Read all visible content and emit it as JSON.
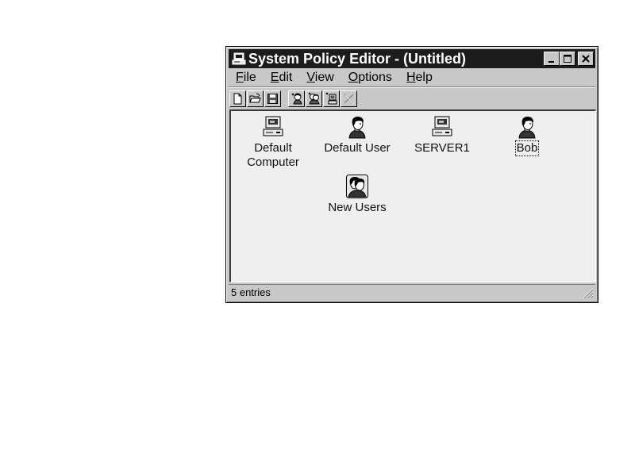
{
  "window": {
    "title": "System Policy Editor - (Untitled)",
    "icon": "policy-editor-icon",
    "controls": {
      "minimize_icon": "minimize-icon",
      "maximize_icon": "maximize-icon",
      "close_icon": "close-icon"
    }
  },
  "menu": [
    {
      "accel": "F",
      "rest": "ile"
    },
    {
      "accel": "E",
      "rest": "dit"
    },
    {
      "accel": "V",
      "rest": "iew"
    },
    {
      "accel": "O",
      "rest": "ptions"
    },
    {
      "accel": "H",
      "rest": "elp"
    }
  ],
  "toolbar": [
    {
      "icon": "new-document-icon"
    },
    {
      "icon": "open-folder-icon"
    },
    {
      "icon": "save-disk-icon"
    },
    {
      "icon": "add-user-icon"
    },
    {
      "icon": "add-group-icon"
    },
    {
      "icon": "add-computer-icon"
    },
    {
      "icon": "remove-icon",
      "disabled": true
    }
  ],
  "entries": [
    {
      "label_line1": "Default",
      "label_line2": "Computer",
      "icon": "computer-icon"
    },
    {
      "label_line1": "Default User",
      "label_line2": "",
      "icon": "user-icon"
    },
    {
      "label_line1": "SERVER1",
      "label_line2": "",
      "icon": "computer-icon"
    },
    {
      "label_line1": "Bob",
      "label_line2": "",
      "icon": "user-icon",
      "focused": true
    },
    {
      "label_line1": "New Users",
      "label_line2": "",
      "icon": "group-icon"
    }
  ],
  "status": {
    "text": "5 entries"
  },
  "colors": {
    "title_bar": "#1c1c1c",
    "chrome": "#c8c8c8",
    "content_bg": "#efefef"
  }
}
